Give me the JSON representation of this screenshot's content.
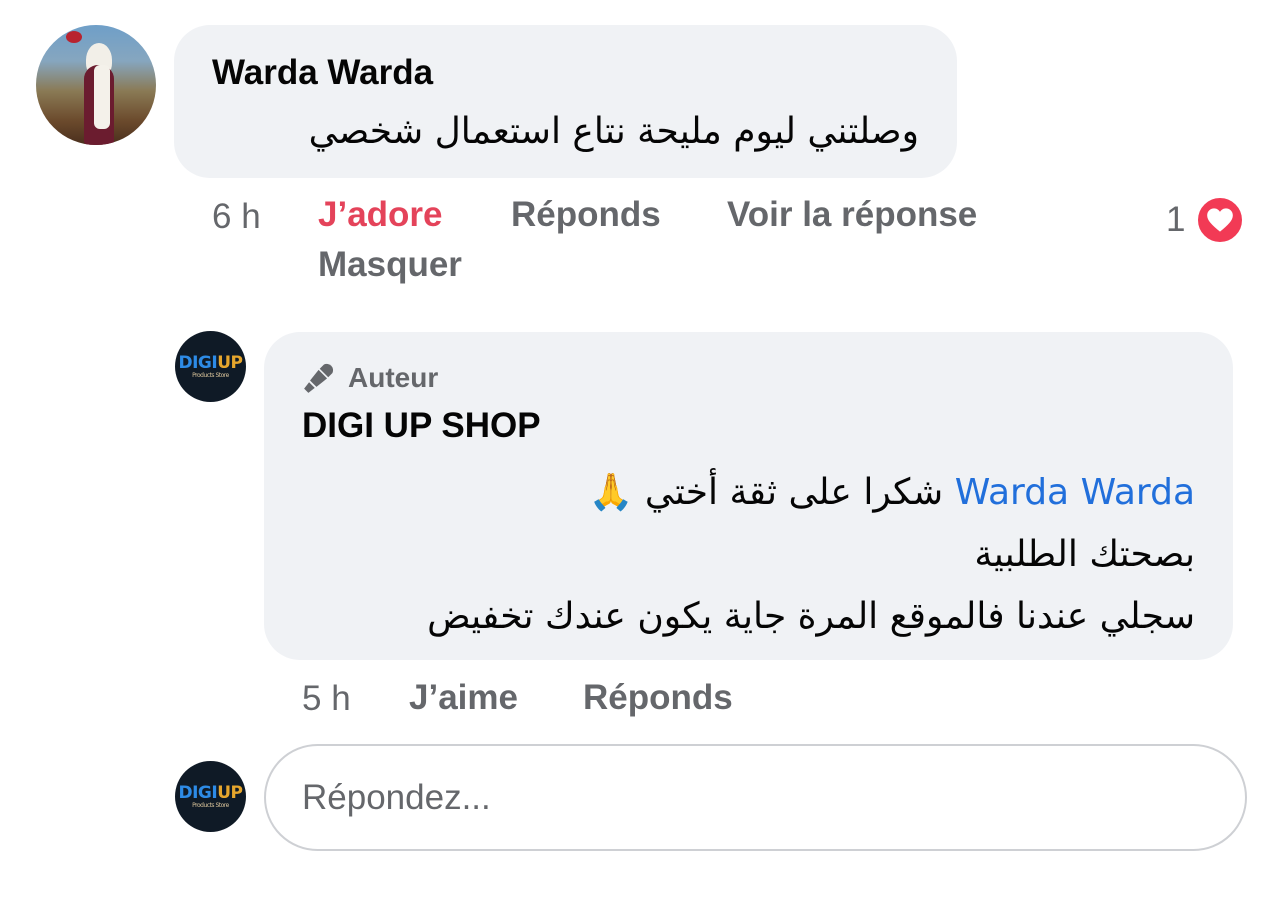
{
  "comment": {
    "author": "Warda Warda",
    "text": "وصلتني ليوم مليحة نتاع استعمال شخصي",
    "time": "6 h",
    "actions": {
      "love": "J’adore",
      "reply": "Réponds",
      "view_reply": "Voir la réponse",
      "hide": "Masquer"
    },
    "reaction_count": "1",
    "reaction_icon": "heart-icon",
    "reaction_color": "#f23a55"
  },
  "reply": {
    "badge_label": "Auteur",
    "badge_icon": "microphone-icon",
    "author": "DIGI UP SHOP",
    "mention": "Warda Warda",
    "line1": "شكرا على ثقة أختي 🙏",
    "line2": "بصحتك الطلبية",
    "line3": "سجلي عندنا فالموقع المرة جاية يكون عندك تخفيض",
    "time": "5 h",
    "actions": {
      "like": "J’aime",
      "reply": "Réponds"
    },
    "avatar_logo": {
      "main": "DIGI",
      "accent": "UP",
      "sub": "Products Store"
    }
  },
  "reply_box": {
    "placeholder": "Répondez..."
  },
  "colors": {
    "bubble_bg": "#f0f2f5",
    "secondary_text": "#65676b",
    "liked": "#e4435a",
    "mention": "#216fdb"
  }
}
